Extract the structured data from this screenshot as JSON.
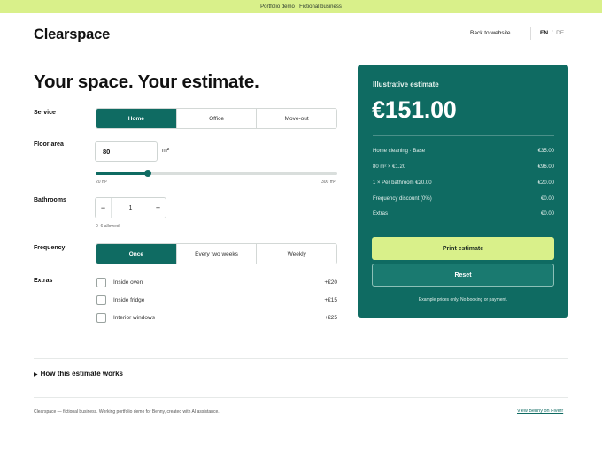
{
  "banner": {
    "text": "Portfolio demo · Fictional business"
  },
  "header": {
    "brand": "Clearspace",
    "back_link": "Back to website",
    "lang_active": "EN",
    "lang_sep": "/",
    "lang_other": "DE"
  },
  "title": "Your space. Your estimate.",
  "service": {
    "label": "Service",
    "options": [
      "Home",
      "Office",
      "Move-out"
    ],
    "selected": "Home"
  },
  "floor_area": {
    "label": "Floor area",
    "value": "80",
    "unit": "m²",
    "slider_min": "20 m²",
    "slider_max": "300 m²",
    "slider_min_value": 20,
    "slider_max_value": 300,
    "slider_value": 80
  },
  "bathrooms": {
    "label": "Bathrooms",
    "minus": "−",
    "plus": "+",
    "value": "1",
    "hint": "0–6 allowed"
  },
  "frequency": {
    "label": "Frequency",
    "options": [
      "Once",
      "Every two weeks",
      "Weekly"
    ],
    "selected": "Once"
  },
  "extras": {
    "label": "Extras",
    "items": [
      {
        "name": "Inside oven",
        "price": "+€20",
        "checked": false
      },
      {
        "name": "Inside fridge",
        "price": "+€15",
        "checked": false
      },
      {
        "name": "Interior windows",
        "price": "+€25",
        "checked": false
      }
    ]
  },
  "estimate": {
    "label": "Illustrative estimate",
    "total": "€151.00",
    "lines": [
      {
        "name": "Home cleaning · Base",
        "amount": "€35.00"
      },
      {
        "name": "80 m² × €1.20",
        "amount": "€96.00"
      },
      {
        "name": "1 × Per bathroom €20.00",
        "amount": "€20.00"
      },
      {
        "name": "Frequency discount (0%)",
        "amount": "€0.00"
      },
      {
        "name": "Extras",
        "amount": "€0.00"
      }
    ],
    "print_label": "Print estimate",
    "reset_label": "Reset",
    "note": "Example prices only. No booking or payment."
  },
  "details": {
    "label": "How this estimate works",
    "marker": "▶"
  },
  "footer": {
    "text": "Clearspace — fictional business. Working portfolio demo for Benny, created with AI assistance.",
    "link": "View Benny on Fiverr"
  },
  "colors": {
    "accent": "#0f6b62",
    "highlight": "#d9f08a"
  }
}
